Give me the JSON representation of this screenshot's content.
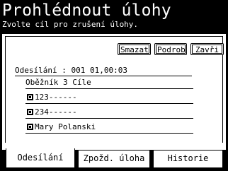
{
  "header": {
    "title": "Prohlédnout úlohy",
    "subtitle": "Zvolte cíl pro zrušení úlohy."
  },
  "toolbar": {
    "delete_label": "Smazat",
    "detail_label": "Podrob",
    "close_label": "Zavři"
  },
  "job": {
    "header": "Odesílání : 001 01,00:03",
    "rows": [
      {
        "label": "Oběžník 3 Cíle",
        "icon": null
      },
      {
        "label": "123------",
        "icon": "fax-icon"
      },
      {
        "label": "234------",
        "icon": "fax-icon"
      },
      {
        "label": "Mary Polanski",
        "icon": "fax-icon"
      }
    ]
  },
  "tabs": [
    {
      "label": "Odesílání",
      "selected": true
    },
    {
      "label": "Zpožd. úloha",
      "selected": false
    },
    {
      "label": "Historie",
      "selected": false
    }
  ]
}
